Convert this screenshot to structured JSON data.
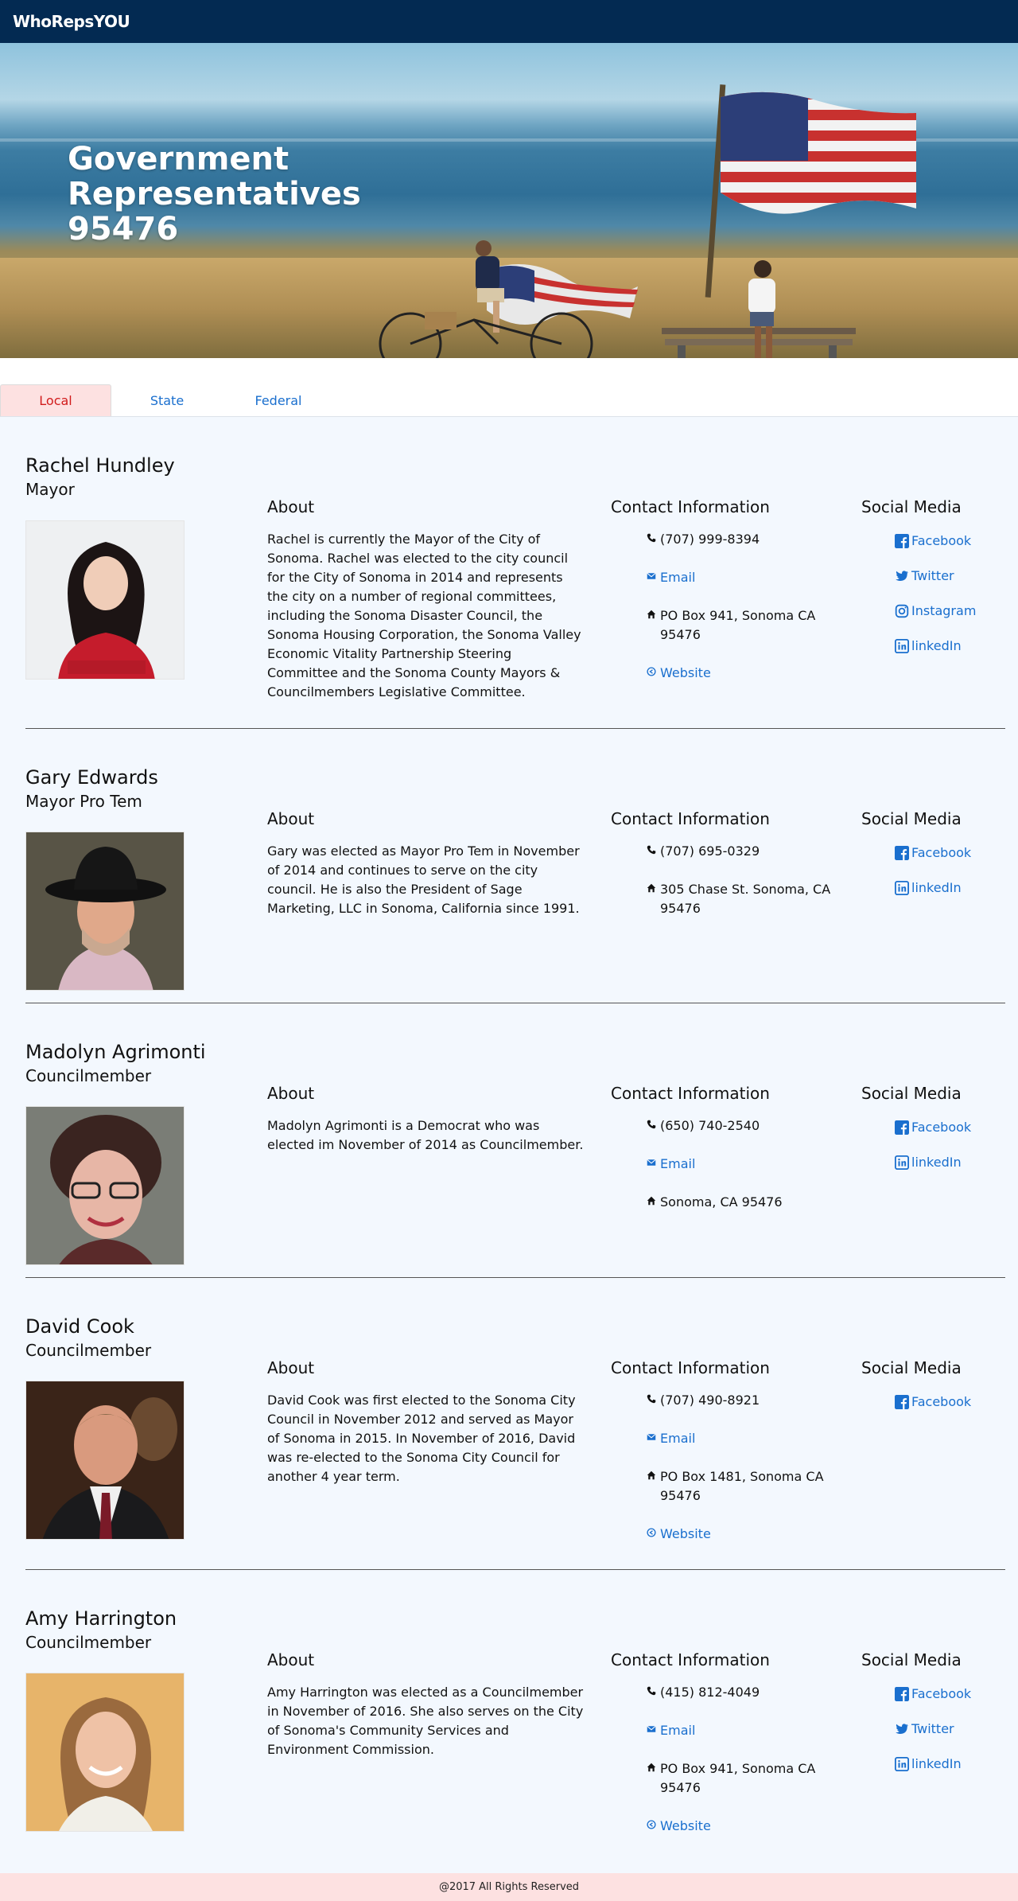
{
  "nav": {
    "brand": "WhoRepsYOU"
  },
  "hero": {
    "title_line1": "Government",
    "title_line2": "Representatives",
    "title_line3": "95476"
  },
  "tabs": [
    {
      "label": "Local",
      "active": true
    },
    {
      "label": "State",
      "active": false
    },
    {
      "label": "Federal",
      "active": false
    }
  ],
  "headings": {
    "about": "About",
    "contact": "Contact Information",
    "social": "Social Media"
  },
  "reps": [
    {
      "name": "Rachel Hundley",
      "title": "Mayor",
      "about": "Rachel is currently the Mayor of the City of Sonoma. Rachel was elected to the city council for the City of Sonoma in 2014 and represents the city on a number of regional committees, including the Sonoma Disaster Council, the Sonoma Housing Corporation, the Sonoma Valley Economic Vitality Partnership Steering Committee and the Sonoma County Mayors & Councilmembers Legislative Committee.",
      "phone": "(707) 999-8394",
      "email": "Email",
      "address": "PO Box 941, Sonoma CA 95476",
      "website": "Website",
      "social": [
        "Facebook",
        "Twitter",
        "Instagram",
        "linkedIn"
      ]
    },
    {
      "name": "Gary Edwards",
      "title": "Mayor Pro Tem",
      "about": "Gary was elected as Mayor Pro Tem in November of 2014 and continues to serve on the city council. He is also the President of Sage Marketing, LLC in Sonoma, California since 1991.",
      "phone": "(707) 695-0329",
      "address": "305 Chase St. Sonoma, CA 95476",
      "social": [
        "Facebook",
        "linkedIn"
      ]
    },
    {
      "name": "Madolyn Agrimonti",
      "title": "Councilmember",
      "about": "Madolyn Agrimonti is a Democrat who was elected im November of 2014 as Councilmember.",
      "phone": "(650) 740-2540",
      "email": "Email",
      "address": "Sonoma, CA 95476",
      "social": [
        "Facebook",
        "linkedIn"
      ]
    },
    {
      "name": "David Cook",
      "title": "Councilmember",
      "about": "David Cook was first elected to the Sonoma City Council in November 2012 and served as Mayor of Sonoma in 2015. In November of 2016, David was re-elected to the Sonoma City Council for another 4 year term.",
      "phone": "(707) 490-8921",
      "email": "Email",
      "address": "PO Box 1481, Sonoma CA 95476",
      "website": "Website",
      "social": [
        "Facebook"
      ]
    },
    {
      "name": "Amy Harrington",
      "title": "Councilmember",
      "about": "Amy Harrington was elected as a Councilmember in November of 2016. She also serves on the City of Sonoma's Community Services and Environment Commission.",
      "phone": "(415) 812-4049",
      "email": "Email",
      "address": "PO Box 941, Sonoma CA 95476",
      "website": "Website",
      "social": [
        "Facebook",
        "Twitter",
        "linkedIn"
      ]
    }
  ],
  "footer": {
    "text": "@2017 All Rights Reserved"
  },
  "colors": {
    "nav": "#032a52",
    "link": "#1a6fce",
    "active_tab": "#d11b1b",
    "footer": "#fde1e1",
    "page": "#f3f8fe"
  }
}
